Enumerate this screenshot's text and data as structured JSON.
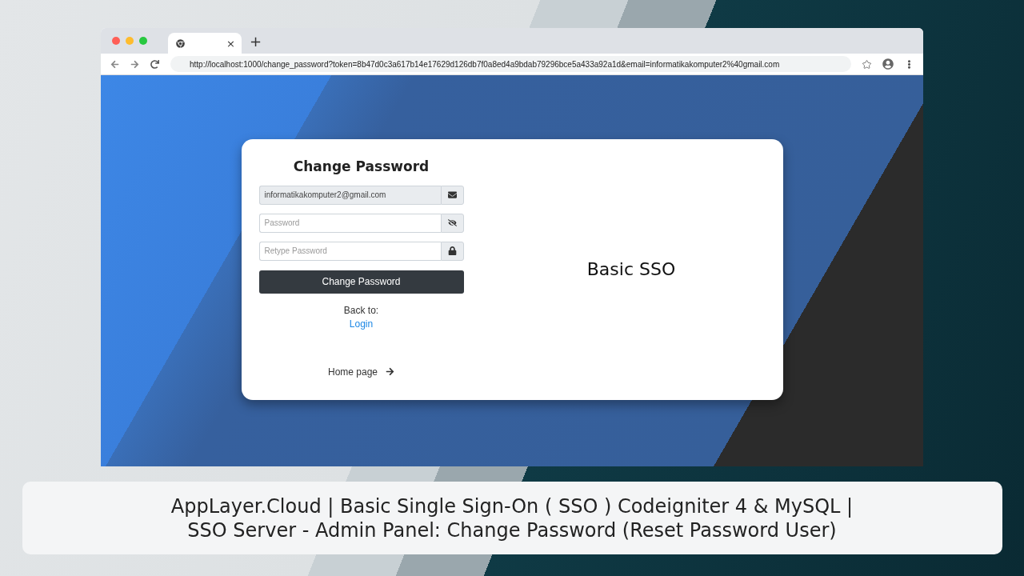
{
  "browser": {
    "url": "http://localhost:1000/change_password?token=8b47d0c3a617b14e17629d126db7f0a8ed4a9bdab79296bce5a433a92a1d&email=informatikakomputer2%40gmail.com",
    "new_tab": "+",
    "tab_close": "×"
  },
  "form": {
    "title": "Change Password",
    "fields": [
      {
        "kind": "email",
        "value": "informatikakomputer2@gmail.com",
        "disabled": true
      },
      {
        "kind": "password",
        "placeholder": "Password",
        "disabled": false
      },
      {
        "kind": "retype",
        "placeholder": "Retype Password",
        "disabled": false
      }
    ],
    "submit": "Change Password",
    "back_label": "Back to:",
    "back_link": "Login",
    "home_link": "Home page"
  },
  "brand": "Basic SSO",
  "caption": [
    "AppLayer.Cloud | Basic Single Sign-On ( SSO ) Codeigniter 4 & MySQL |",
    "SSO Server - Admin Panel: Change Password (Reset Password User)"
  ]
}
